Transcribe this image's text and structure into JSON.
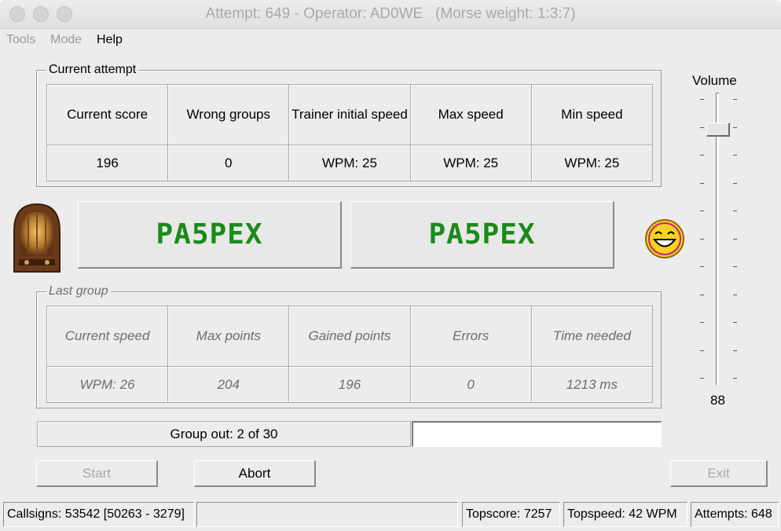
{
  "window": {
    "title": "Attempt: 649 - Operator: AD0WE   (Morse weight: 1:3:7)"
  },
  "menu": {
    "tools": "Tools",
    "mode": "Mode",
    "help": "Help"
  },
  "current_attempt": {
    "title": "Current attempt",
    "headers": [
      "Current score",
      "Wrong groups",
      "Trainer initial speed",
      "Max speed",
      "Min speed"
    ],
    "values": [
      "196",
      "0",
      "WPM: 25",
      "WPM: 25",
      "WPM: 25"
    ]
  },
  "callsigns": {
    "sent": "PA5PEX",
    "received": "PA5PEX",
    "radio_icon": "vintage-radio-icon",
    "result_icon": "laughing-smiley-icon"
  },
  "last_group": {
    "title": "Last group",
    "headers": [
      "Current speed",
      "Max points",
      "Gained points",
      "Errors",
      "Time needed"
    ],
    "values": [
      "WPM: 26",
      "204",
      "196",
      "0",
      "1213 ms"
    ]
  },
  "progress": {
    "label": "Group out: 2 of 30",
    "fraction": 0.0
  },
  "buttons": {
    "start": "Start",
    "abort": "Abort",
    "exit": "Exit"
  },
  "volume": {
    "label": "Volume",
    "value": "88"
  },
  "status": {
    "callsigns": "Callsigns: 53542 [50263 - 3279]",
    "empty": "",
    "topscore": "Topscore: 7257",
    "topspeed": "Topspeed: 42 WPM",
    "attempts": "Attempts: 648"
  },
  "colors": {
    "callsign_text": "#1a8a1a",
    "window_bg": "#ececec"
  }
}
